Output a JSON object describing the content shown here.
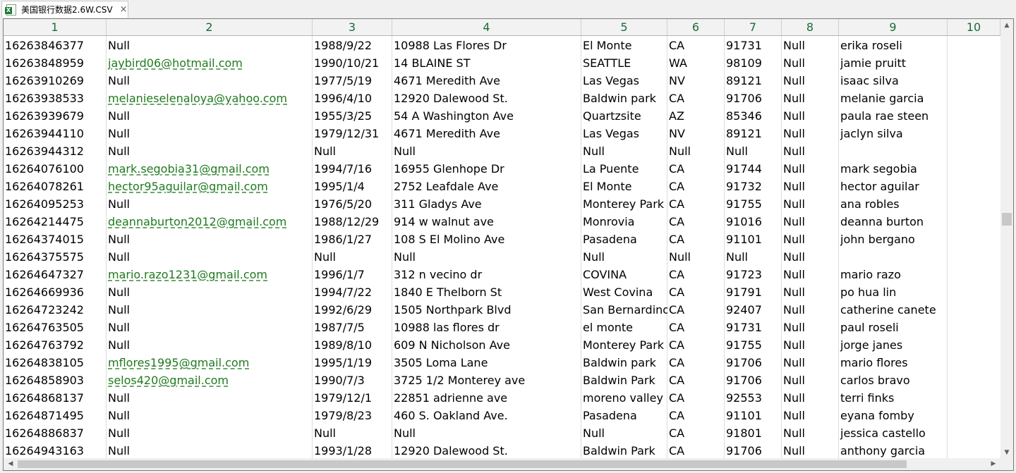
{
  "tab": {
    "title": "美国银行数据2.6W.CSV",
    "close": "×",
    "icon": "excel-file-icon"
  },
  "columns": [
    "1",
    "2",
    "3",
    "4",
    "5",
    "6",
    "7",
    "8",
    "9",
    "10"
  ],
  "rows": [
    [
      "16263846377",
      "Null",
      "1988/9/22",
      "10988 Las Flores Dr",
      "El Monte",
      "CA",
      "91731",
      "Null",
      "erika roseli",
      ""
    ],
    [
      "16263848959",
      "jaybird06@hotmail.com",
      "1990/10/21",
      "14 BLAINE ST",
      "SEATTLE",
      "WA",
      "98109",
      "Null",
      "jamie pruitt",
      ""
    ],
    [
      "16263910269",
      "Null",
      "1977/5/19",
      "4671 Meredith Ave",
      "Las Vegas",
      "NV",
      "89121",
      "Null",
      "isaac silva",
      ""
    ],
    [
      "16263938533",
      "melanieselenaloya@yahoo.com",
      "1996/4/10",
      "12920 Dalewood St.",
      "Baldwin park",
      "CA",
      "91706",
      "Null",
      "melanie garcia",
      ""
    ],
    [
      "16263939679",
      "Null",
      "1955/3/25",
      "54 A Washington Ave",
      "Quartzsite",
      "AZ",
      "85346",
      "Null",
      "paula  rae steen",
      ""
    ],
    [
      "16263944110",
      "Null",
      "1979/12/31",
      "4671 Meredith Ave",
      "Las Vegas",
      "NV",
      "89121",
      "Null",
      "jaclyn silva",
      ""
    ],
    [
      "16263944312",
      "Null",
      "Null",
      "Null",
      "Null",
      "Null",
      "Null",
      "Null",
      "",
      ""
    ],
    [
      "16264076100",
      "mark.segobia31@gmail.com",
      "1994/7/16",
      "16955 Glenhope Dr",
      "La Puente",
      "CA",
      "91744",
      "Null",
      "mark segobia",
      ""
    ],
    [
      "16264078261",
      "hector95aguilar@gmail.com",
      "1995/1/4",
      "2752 Leafdale Ave",
      "El Monte",
      "CA",
      "91732",
      "Null",
      "hector aguilar",
      ""
    ],
    [
      "16264095253",
      "Null",
      "1976/5/20",
      "311 Gladys Ave",
      "Monterey Park",
      "CA",
      "91755",
      "Null",
      "ana robles",
      ""
    ],
    [
      "16264214475",
      "deannaburton2012@gmail.com",
      "1988/12/29",
      "914 w walnut ave",
      "Monrovia",
      "CA",
      "91016",
      "Null",
      "deanna burton",
      ""
    ],
    [
      "16264374015",
      "Null",
      "1986/1/27",
      "108 S El Molino Ave",
      "Pasadena",
      "CA",
      "91101",
      "Null",
      "john bergano",
      ""
    ],
    [
      "16264375575",
      "Null",
      "Null",
      "Null",
      "Null",
      "Null",
      "Null",
      "Null",
      "",
      ""
    ],
    [
      "16264647327",
      "mario.razo1231@gmail.com",
      "1996/1/7",
      "312 n vecino dr",
      "COVINA",
      "CA",
      "91723",
      "Null",
      "mario razo",
      ""
    ],
    [
      "16264669936",
      "Null",
      "1994/7/22",
      "1840 E Thelborn St",
      "West Covina",
      "CA",
      "91791",
      "Null",
      "po hua lin",
      ""
    ],
    [
      "16264723242",
      "Null",
      "1992/6/29",
      "1505 Northpark Blvd",
      "San Bernardino",
      "CA",
      "92407",
      "Null",
      "catherine canete",
      ""
    ],
    [
      "16264763505",
      "Null",
      "1987/7/5",
      "10988 las flores dr",
      "el monte",
      "CA",
      "91731",
      "Null",
      "paul roseli",
      ""
    ],
    [
      "16264763792",
      "Null",
      "1989/8/10",
      "609 N Nicholson Ave",
      "Monterey Park",
      "CA",
      "91755",
      "Null",
      "jorge janes",
      ""
    ],
    [
      "16264838105",
      "mflores1995@gmail.com",
      "1995/1/19",
      "3505 Loma Lane",
      "Baldwin park",
      "CA",
      "91706",
      "Null",
      "mario flores",
      ""
    ],
    [
      "16264858903",
      "selos420@gmail.com",
      "1990/7/3",
      "3725 1/2 Monterey ave",
      "Baldwin Park",
      "CA",
      "91706",
      "Null",
      "carlos bravo",
      ""
    ],
    [
      "16264868137",
      "Null",
      "1979/12/1",
      "22851 adrienne ave",
      "moreno valley",
      "CA",
      "92553",
      "Null",
      "terri finks",
      ""
    ],
    [
      "16264871495",
      "Null",
      "1979/8/23",
      "460 S. Oakland Ave.",
      "Pasadena",
      "CA",
      "91101",
      "Null",
      "eyana fomby",
      ""
    ],
    [
      "16264886837",
      "Null",
      "Null",
      "Null",
      "Null",
      "CA",
      "91801",
      "Null",
      "jessica castello",
      ""
    ],
    [
      "16264943163",
      "Null",
      "1993/1/28",
      "12920 Dalewood St.",
      "Baldwin Park",
      "CA",
      "91706",
      "Null",
      "anthony garcia",
      ""
    ]
  ],
  "scroll": {
    "up": "▲",
    "down": "▼",
    "left": "◀",
    "right": "▶"
  }
}
